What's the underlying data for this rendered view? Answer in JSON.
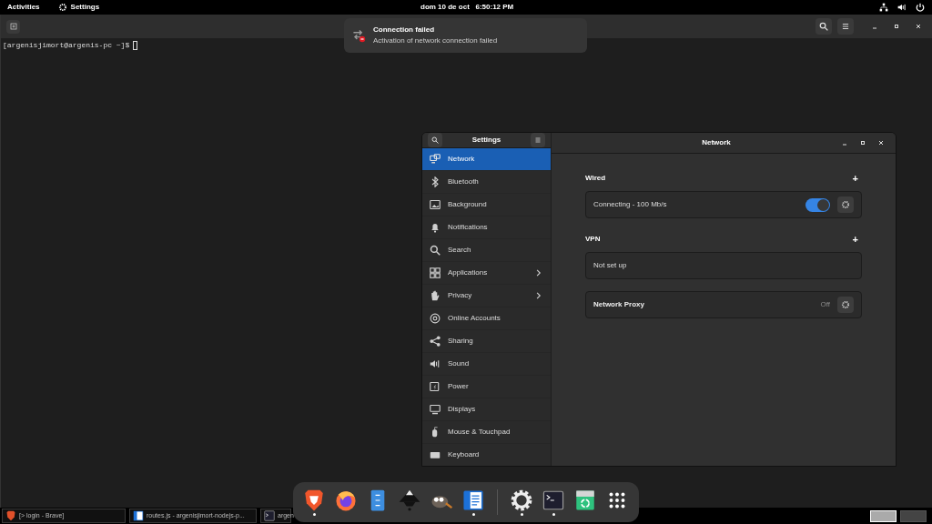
{
  "top_bar": {
    "activities": "Activities",
    "app_menu": "Settings",
    "clock": "dom 10 de oct   6:50:12 PM"
  },
  "terminal": {
    "prompt": "[argenisjimort@argenis-pc ~]$"
  },
  "notification": {
    "title": "Connection failed",
    "body": "Activation of network connection failed"
  },
  "settings": {
    "sidebar_title": "Settings",
    "page_title": "Network",
    "sidebar": [
      {
        "label": "Network",
        "selected": true,
        "chevron": false
      },
      {
        "label": "Bluetooth",
        "selected": false,
        "chevron": false
      },
      {
        "label": "Background",
        "selected": false,
        "chevron": false
      },
      {
        "label": "Notifications",
        "selected": false,
        "chevron": false
      },
      {
        "label": "Search",
        "selected": false,
        "chevron": false
      },
      {
        "label": "Applications",
        "selected": false,
        "chevron": true
      },
      {
        "label": "Privacy",
        "selected": false,
        "chevron": true
      },
      {
        "label": "Online Accounts",
        "selected": false,
        "chevron": false
      },
      {
        "label": "Sharing",
        "selected": false,
        "chevron": false
      },
      {
        "label": "Sound",
        "selected": false,
        "chevron": false
      },
      {
        "label": "Power",
        "selected": false,
        "chevron": false
      },
      {
        "label": "Displays",
        "selected": false,
        "chevron": false
      },
      {
        "label": "Mouse & Touchpad",
        "selected": false,
        "chevron": false
      },
      {
        "label": "Keyboard",
        "selected": false,
        "chevron": false
      }
    ],
    "sections": [
      {
        "heading": "Wired",
        "add": "+",
        "row": {
          "kind": "toggle",
          "label": "Connecting - 100 Mb/s",
          "on": true
        }
      },
      {
        "heading": "VPN",
        "add": "+",
        "row": {
          "kind": "plain",
          "label": "Not set up"
        }
      },
      {
        "row": {
          "kind": "status",
          "label": "Network Proxy",
          "status": "Off"
        }
      }
    ]
  },
  "dock": [
    {
      "running": true
    },
    {
      "running": false
    },
    {
      "running": false
    },
    {
      "running": false
    },
    {
      "running": false
    },
    {
      "running": true
    },
    {
      "running": true
    },
    {
      "running": true
    },
    {
      "running": false
    },
    {
      "running": false
    }
  ],
  "taskbar": [
    {
      "label": "[> login - Brave]"
    },
    {
      "label": "routes.js - argenisjimort-nodejs-p..."
    },
    {
      "label": "argen"
    }
  ],
  "workspaces": [
    {
      "selected": true
    },
    {
      "selected": false
    }
  ]
}
